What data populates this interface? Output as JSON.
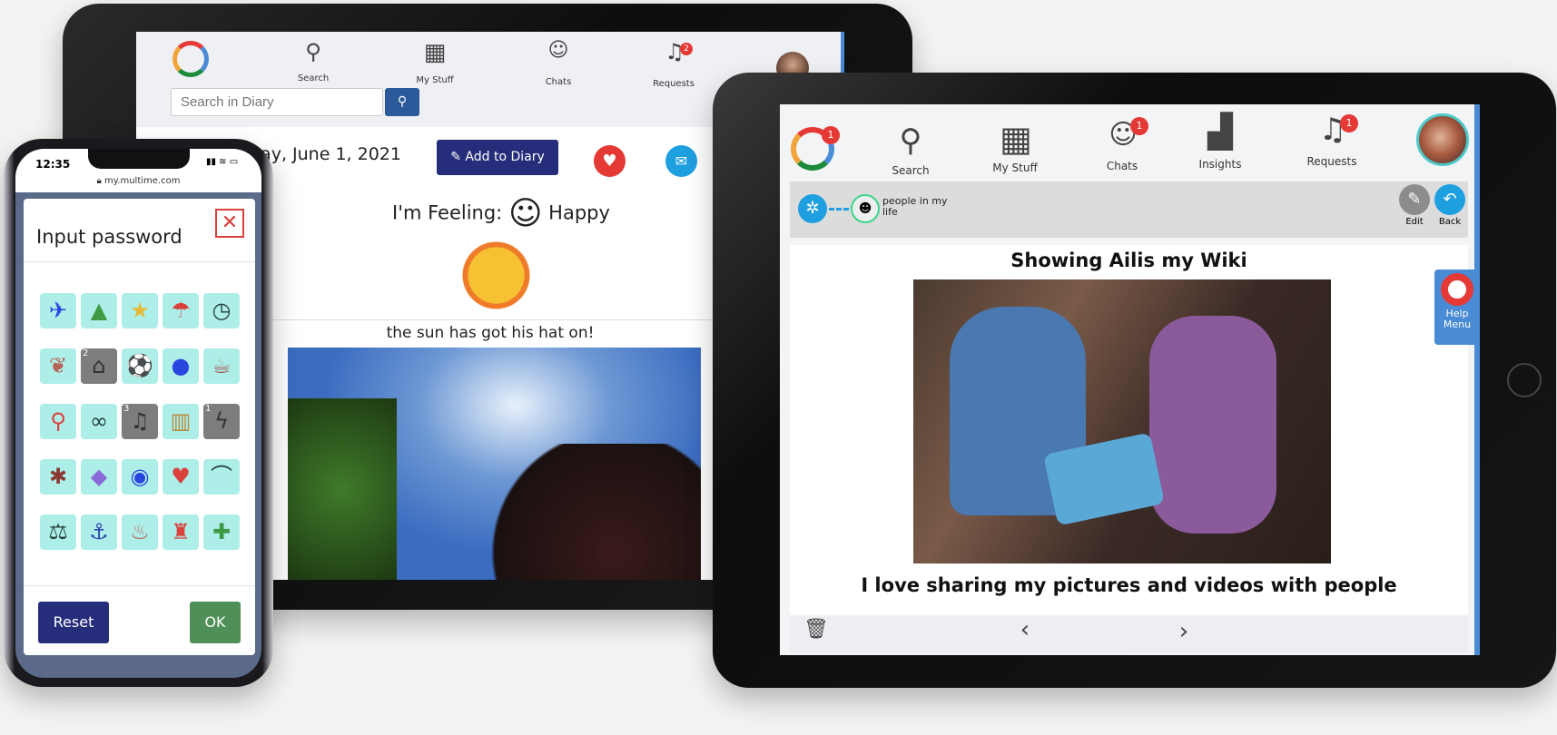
{
  "diary_tablet": {
    "nav": [
      {
        "label": "Search",
        "icon": "search-user-icon"
      },
      {
        "label": "My Stuff",
        "icon": "grid-icon"
      },
      {
        "label": "Chats",
        "icon": "chat-icon"
      },
      {
        "label": "Requests",
        "icon": "bell-icon",
        "badge": "2"
      }
    ],
    "search_placeholder": "Search in Diary",
    "date": "day, June 1, 2021",
    "add_button": "Add to Diary",
    "feeling_label": "I'm Feeling:",
    "feeling_value": "Happy",
    "caption": "the sun has got his hat on!"
  },
  "phone": {
    "time": "12:35",
    "url": "my.multime.com",
    "dialog_title": "Input password",
    "icons": [
      {
        "g": "✈",
        "c": "#2a45e0"
      },
      {
        "g": "▲",
        "c": "#3f9a45"
      },
      {
        "g": "★",
        "c": "#e6b93a"
      },
      {
        "g": "☂",
        "c": "#d9413a"
      },
      {
        "g": "◷",
        "c": "#24403c"
      },
      {
        "g": "❦",
        "c": "#b7635a"
      },
      {
        "g": "⌂",
        "c": "#444",
        "sel": "2"
      },
      {
        "g": "⚽",
        "c": "#24403c"
      },
      {
        "g": "●",
        "c": "#2a45e0"
      },
      {
        "g": "☕",
        "c": "#a06158"
      },
      {
        "g": "⚲",
        "c": "#d9413a"
      },
      {
        "g": "∞",
        "c": "#24403c"
      },
      {
        "g": "♫",
        "c": "#444",
        "sel": "3"
      },
      {
        "g": "▥",
        "c": "#b98a3c"
      },
      {
        "g": "ϟ",
        "c": "#444",
        "sel": "1"
      },
      {
        "g": "✱",
        "c": "#8a3a32"
      },
      {
        "g": "◆",
        "c": "#8a6ad8"
      },
      {
        "g": "◉",
        "c": "#2a45e0"
      },
      {
        "g": "♥",
        "c": "#d9413a"
      },
      {
        "g": "⌒",
        "c": "#24403c"
      },
      {
        "g": "⚖",
        "c": "#24403c"
      },
      {
        "g": "⚓",
        "c": "#2a45b0"
      },
      {
        "g": "♨",
        "c": "#b7635a"
      },
      {
        "g": "♜",
        "c": "#d9413a"
      },
      {
        "g": "✚",
        "c": "#3f9a45"
      }
    ],
    "reset": "Reset",
    "ok": "OK"
  },
  "wiki_tablet": {
    "logo_badge": "1",
    "nav": [
      {
        "label": "Search",
        "icon": "search-user-icon"
      },
      {
        "label": "My Stuff",
        "icon": "grid-icon"
      },
      {
        "label": "Chats",
        "icon": "chat-icon",
        "badge": "1"
      },
      {
        "label": "Insights",
        "icon": "bar-chart-icon"
      },
      {
        "label": "Requests",
        "icon": "bell-icon",
        "badge": "1"
      }
    ],
    "breadcrumb": "people in my life",
    "edit": "Edit",
    "back": "Back",
    "title": "Showing Ailis my Wiki",
    "caption": "I love sharing my pictures and videos with people",
    "help": "Help Menu"
  },
  "colors": {
    "navy": "#262d7a",
    "green": "#4f8f58",
    "blue": "#1e9fe0",
    "red": "#e53935",
    "mint": "#aeeee9"
  }
}
